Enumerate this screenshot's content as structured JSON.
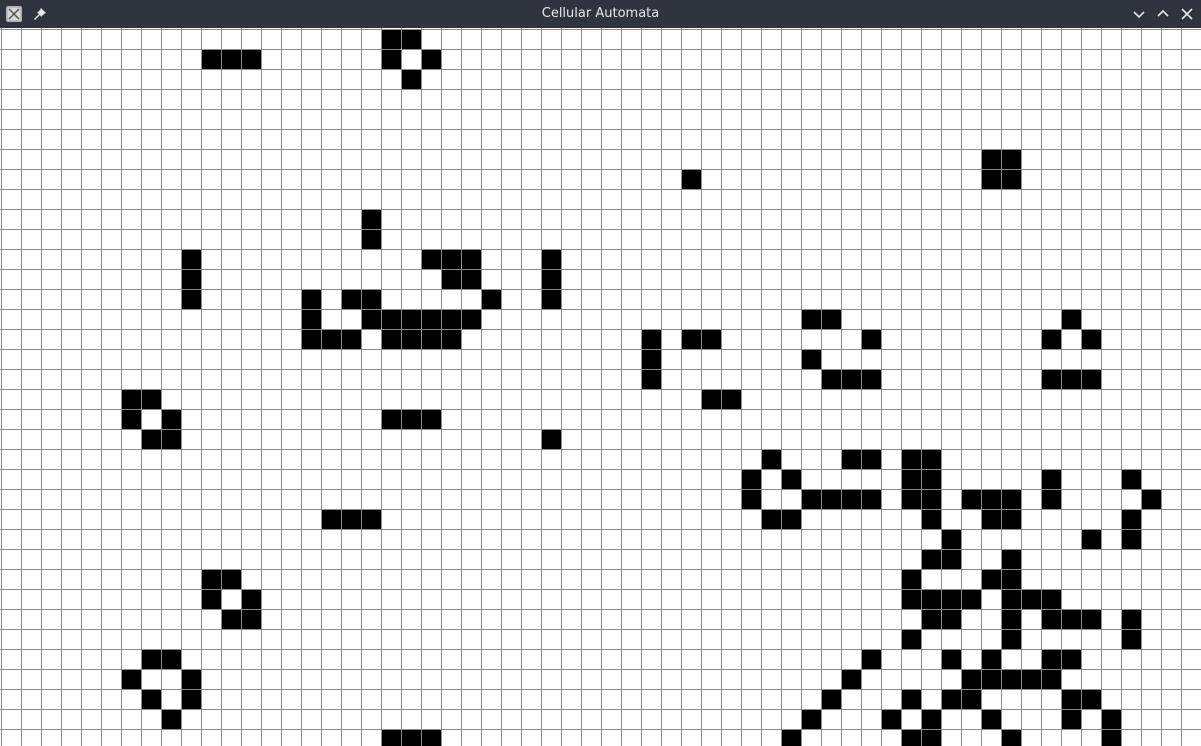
{
  "window": {
    "title": "Cellular Automata",
    "app_icon": "app-icon",
    "pin_icon": "pin-icon",
    "buttons": [
      {
        "name": "minimize-button",
        "icon": "chevron-down-icon"
      },
      {
        "name": "maximize-button",
        "icon": "chevron-up-icon"
      },
      {
        "name": "close-button",
        "icon": "close-icon"
      }
    ]
  },
  "grid": {
    "live_color": "#000000",
    "dead_color": "#ffffff",
    "line_color": "#8c8c8c",
    "live_cells": [
      [
        10,
        1
      ],
      [
        11,
        1
      ],
      [
        12,
        1
      ],
      [
        19,
        0
      ],
      [
        20,
        0
      ],
      [
        19,
        1
      ],
      [
        21,
        1
      ],
      [
        20,
        2
      ],
      [
        49,
        6
      ],
      [
        50,
        6
      ],
      [
        49,
        7
      ],
      [
        50,
        7
      ],
      [
        34,
        7
      ],
      [
        18,
        9
      ],
      [
        18,
        10
      ],
      [
        9,
        11
      ],
      [
        9,
        12
      ],
      [
        9,
        13
      ],
      [
        21,
        11
      ],
      [
        22,
        11
      ],
      [
        23,
        11
      ],
      [
        22,
        12
      ],
      [
        23,
        12
      ],
      [
        27,
        11
      ],
      [
        27,
        12
      ],
      [
        27,
        13
      ],
      [
        15,
        13
      ],
      [
        17,
        13
      ],
      [
        18,
        13
      ],
      [
        24,
        13
      ],
      [
        15,
        14
      ],
      [
        18,
        14
      ],
      [
        19,
        14
      ],
      [
        20,
        14
      ],
      [
        21,
        14
      ],
      [
        22,
        14
      ],
      [
        23,
        14
      ],
      [
        15,
        15
      ],
      [
        16,
        15
      ],
      [
        17,
        15
      ],
      [
        19,
        15
      ],
      [
        20,
        15
      ],
      [
        21,
        15
      ],
      [
        22,
        15
      ],
      [
        40,
        14
      ],
      [
        41,
        14
      ],
      [
        53,
        14
      ],
      [
        32,
        15
      ],
      [
        34,
        15
      ],
      [
        35,
        15
      ],
      [
        43,
        15
      ],
      [
        52,
        15
      ],
      [
        54,
        15
      ],
      [
        32,
        16
      ],
      [
        40,
        16
      ],
      [
        32,
        17
      ],
      [
        41,
        17
      ],
      [
        42,
        17
      ],
      [
        43,
        17
      ],
      [
        52,
        17
      ],
      [
        53,
        17
      ],
      [
        54,
        17
      ],
      [
        35,
        18
      ],
      [
        36,
        18
      ],
      [
        6,
        18
      ],
      [
        7,
        18
      ],
      [
        6,
        19
      ],
      [
        8,
        19
      ],
      [
        7,
        20
      ],
      [
        8,
        20
      ],
      [
        19,
        19
      ],
      [
        20,
        19
      ],
      [
        21,
        19
      ],
      [
        27,
        20
      ],
      [
        38,
        21
      ],
      [
        42,
        21
      ],
      [
        43,
        21
      ],
      [
        45,
        21
      ],
      [
        46,
        21
      ],
      [
        37,
        22
      ],
      [
        39,
        22
      ],
      [
        45,
        22
      ],
      [
        46,
        22
      ],
      [
        52,
        22
      ],
      [
        56,
        22
      ],
      [
        37,
        23
      ],
      [
        40,
        23
      ],
      [
        41,
        23
      ],
      [
        42,
        23
      ],
      [
        43,
        23
      ],
      [
        45,
        23
      ],
      [
        46,
        23
      ],
      [
        48,
        23
      ],
      [
        49,
        23
      ],
      [
        50,
        23
      ],
      [
        52,
        23
      ],
      [
        57,
        23
      ],
      [
        16,
        24
      ],
      [
        17,
        24
      ],
      [
        18,
        24
      ],
      [
        38,
        24
      ],
      [
        39,
        24
      ],
      [
        46,
        24
      ],
      [
        49,
        24
      ],
      [
        50,
        24
      ],
      [
        56,
        24
      ],
      [
        47,
        25
      ],
      [
        54,
        25
      ],
      [
        56,
        25
      ],
      [
        46,
        26
      ],
      [
        47,
        26
      ],
      [
        50,
        26
      ],
      [
        10,
        27
      ],
      [
        11,
        27
      ],
      [
        45,
        27
      ],
      [
        49,
        27
      ],
      [
        50,
        27
      ],
      [
        10,
        28
      ],
      [
        12,
        28
      ],
      [
        45,
        28
      ],
      [
        46,
        28
      ],
      [
        47,
        28
      ],
      [
        48,
        28
      ],
      [
        50,
        28
      ],
      [
        51,
        28
      ],
      [
        52,
        28
      ],
      [
        11,
        29
      ],
      [
        12,
        29
      ],
      [
        46,
        29
      ],
      [
        47,
        29
      ],
      [
        50,
        29
      ],
      [
        52,
        29
      ],
      [
        53,
        29
      ],
      [
        54,
        29
      ],
      [
        56,
        29
      ],
      [
        7,
        31
      ],
      [
        8,
        31
      ],
      [
        45,
        30
      ],
      [
        50,
        30
      ],
      [
        56,
        30
      ],
      [
        43,
        31
      ],
      [
        47,
        31
      ],
      [
        49,
        31
      ],
      [
        52,
        31
      ],
      [
        53,
        31
      ],
      [
        6,
        32
      ],
      [
        9,
        32
      ],
      [
        42,
        32
      ],
      [
        48,
        32
      ],
      [
        49,
        32
      ],
      [
        50,
        32
      ],
      [
        51,
        32
      ],
      [
        52,
        32
      ],
      [
        7,
        33
      ],
      [
        9,
        33
      ],
      [
        41,
        33
      ],
      [
        45,
        33
      ],
      [
        47,
        33
      ],
      [
        48,
        33
      ],
      [
        53,
        33
      ],
      [
        54,
        33
      ],
      [
        8,
        34
      ],
      [
        40,
        34
      ],
      [
        44,
        34
      ],
      [
        46,
        34
      ],
      [
        49,
        34
      ],
      [
        53,
        34
      ],
      [
        55,
        34
      ],
      [
        19,
        35
      ],
      [
        20,
        35
      ],
      [
        21,
        35
      ],
      [
        39,
        35
      ],
      [
        45,
        35
      ],
      [
        46,
        35
      ],
      [
        50,
        35
      ],
      [
        55,
        35
      ]
    ]
  }
}
